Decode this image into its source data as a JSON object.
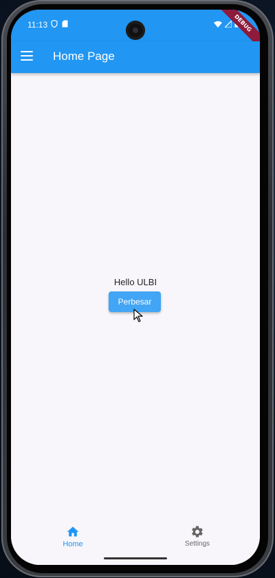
{
  "status_bar": {
    "time": "11:13",
    "debug_label": "DEBUG"
  },
  "app_bar": {
    "title": "Home Page"
  },
  "content": {
    "text": "Hello ULBI",
    "button_label": "Perbesar"
  },
  "bottom_nav": {
    "items": [
      {
        "label": "Home",
        "icon": "home-icon",
        "active": true
      },
      {
        "label": "Settings",
        "icon": "gear-icon",
        "active": false
      }
    ]
  },
  "colors": {
    "app_bar": "#2196f3",
    "button": "#42a5f5",
    "active_nav": "#2196f3",
    "background": "#f8f6fa",
    "debug_ribbon": "#8e1b3b"
  }
}
